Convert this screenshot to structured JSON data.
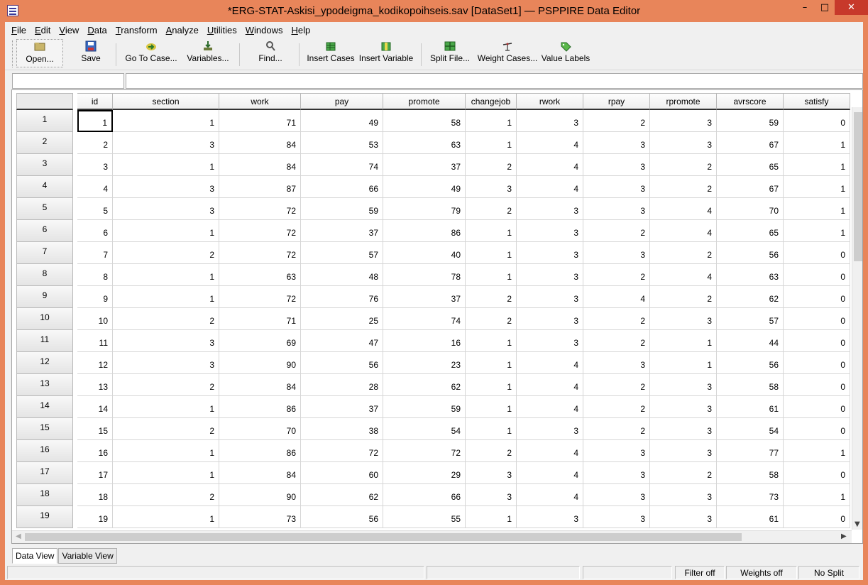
{
  "window": {
    "title": "*ERG-STAT-Askisi_ypodeigma_kodikopoihseis.sav [DataSet1] — PSPPIRE Data Editor",
    "minimize": "–",
    "maximize": "□",
    "close": "✕"
  },
  "menu": [
    "File",
    "Edit",
    "View",
    "Data",
    "Transform",
    "Analyze",
    "Utilities",
    "Windows",
    "Help"
  ],
  "toolbar": {
    "open": "Open...",
    "save": "Save",
    "goto_case": "Go To Case...",
    "variables": "Variables...",
    "find": "Find...",
    "insert_cases": "Insert Cases",
    "insert_variable": "Insert Variable",
    "split_file": "Split File...",
    "weight_cases": "Weight Cases...",
    "value_labels": "Value Labels"
  },
  "grid": {
    "columns": [
      "id",
      "section",
      "work",
      "pay",
      "promote",
      "changejob",
      "rwork",
      "rpay",
      "rpromote",
      "avrscore",
      "satisfy"
    ],
    "row_numbers": [
      "1",
      "2",
      "3",
      "4",
      "5",
      "6",
      "7",
      "8",
      "9",
      "10",
      "11",
      "12",
      "13",
      "14",
      "15",
      "16",
      "17",
      "18",
      "19"
    ],
    "rows": [
      [
        "1",
        "1",
        "71",
        "49",
        "58",
        "1",
        "3",
        "2",
        "3",
        "59",
        "0"
      ],
      [
        "2",
        "3",
        "84",
        "53",
        "63",
        "1",
        "4",
        "3",
        "3",
        "67",
        "1"
      ],
      [
        "3",
        "1",
        "84",
        "74",
        "37",
        "2",
        "4",
        "3",
        "2",
        "65",
        "1"
      ],
      [
        "4",
        "3",
        "87",
        "66",
        "49",
        "3",
        "4",
        "3",
        "2",
        "67",
        "1"
      ],
      [
        "5",
        "3",
        "72",
        "59",
        "79",
        "2",
        "3",
        "3",
        "4",
        "70",
        "1"
      ],
      [
        "6",
        "1",
        "72",
        "37",
        "86",
        "1",
        "3",
        "2",
        "4",
        "65",
        "1"
      ],
      [
        "7",
        "2",
        "72",
        "57",
        "40",
        "1",
        "3",
        "3",
        "2",
        "56",
        "0"
      ],
      [
        "8",
        "1",
        "63",
        "48",
        "78",
        "1",
        "3",
        "2",
        "4",
        "63",
        "0"
      ],
      [
        "9",
        "1",
        "72",
        "76",
        "37",
        "2",
        "3",
        "4",
        "2",
        "62",
        "0"
      ],
      [
        "10",
        "2",
        "71",
        "25",
        "74",
        "2",
        "3",
        "2",
        "3",
        "57",
        "0"
      ],
      [
        "11",
        "3",
        "69",
        "47",
        "16",
        "1",
        "3",
        "2",
        "1",
        "44",
        "0"
      ],
      [
        "12",
        "3",
        "90",
        "56",
        "23",
        "1",
        "4",
        "3",
        "1",
        "56",
        "0"
      ],
      [
        "13",
        "2",
        "84",
        "28",
        "62",
        "1",
        "4",
        "2",
        "3",
        "58",
        "0"
      ],
      [
        "14",
        "1",
        "86",
        "37",
        "59",
        "1",
        "4",
        "2",
        "3",
        "61",
        "0"
      ],
      [
        "15",
        "2",
        "70",
        "38",
        "54",
        "1",
        "3",
        "2",
        "3",
        "54",
        "0"
      ],
      [
        "16",
        "1",
        "86",
        "72",
        "72",
        "2",
        "4",
        "3",
        "3",
        "77",
        "1"
      ],
      [
        "17",
        "1",
        "84",
        "60",
        "29",
        "3",
        "4",
        "3",
        "2",
        "58",
        "0"
      ],
      [
        "18",
        "2",
        "90",
        "62",
        "66",
        "3",
        "4",
        "3",
        "3",
        "73",
        "1"
      ],
      [
        "19",
        "1",
        "73",
        "56",
        "55",
        "1",
        "3",
        "3",
        "3",
        "61",
        "0"
      ]
    ]
  },
  "tabs": [
    "Data View",
    "Variable View"
  ],
  "status": {
    "filter": "Filter off",
    "weights": "Weights off",
    "split": "No Split"
  },
  "colors": {
    "title_bar": "#E8855A",
    "close_button": "#C7392B"
  }
}
